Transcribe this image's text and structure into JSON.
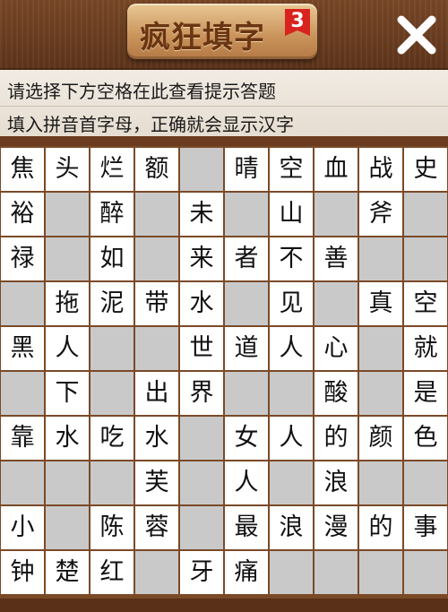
{
  "header": {
    "title": "疯狂填字",
    "level": "3",
    "close_icon": "close-icon"
  },
  "hint": {
    "line1": "请选择下方空格在此查看提示答题",
    "line2": "填入拼音首字母，正确就会显示汉字"
  },
  "grid": {
    "rows": 10,
    "cols": 10,
    "cells": [
      [
        "焦",
        "头",
        "烂",
        "额",
        "",
        "晴",
        "空",
        "血",
        "战",
        "史"
      ],
      [
        "裕",
        "",
        "醉",
        "",
        "未",
        "",
        "山",
        "",
        "斧",
        ""
      ],
      [
        "禄",
        "",
        "如",
        "",
        "来",
        "者",
        "不",
        "善",
        "",
        ""
      ],
      [
        "",
        "拖",
        "泥",
        "带",
        "水",
        "",
        "见",
        "",
        "真",
        "空"
      ],
      [
        "黑",
        "人",
        "",
        "",
        "世",
        "道",
        "人",
        "心",
        "",
        "就"
      ],
      [
        "",
        "下",
        "",
        "出",
        "界",
        "",
        "",
        "酸",
        "",
        "是"
      ],
      [
        "靠",
        "水",
        "吃",
        "水",
        "",
        "女",
        "人",
        "的",
        "颜",
        "色"
      ],
      [
        "",
        "",
        "",
        "芙",
        "",
        "人",
        "",
        "浪",
        "",
        ""
      ],
      [
        "小",
        "",
        "陈",
        "蓉",
        "",
        "最",
        "浪",
        "漫",
        "的",
        "事"
      ],
      [
        "钟",
        "楚",
        "红",
        "",
        "牙",
        "痛",
        "",
        "",
        "",
        ""
      ]
    ]
  }
}
